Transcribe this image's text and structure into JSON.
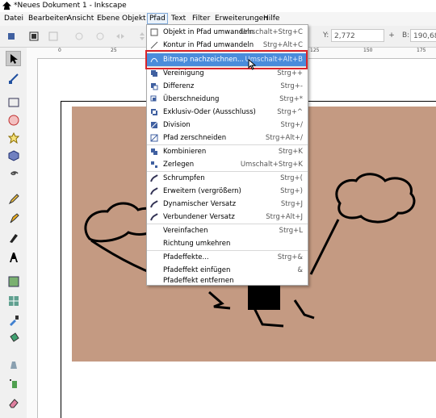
{
  "window": {
    "title": "*Neues Dokument 1 - Inkscape"
  },
  "menubar": {
    "items": [
      "Datei",
      "Bearbeiten",
      "Ansicht",
      "Ebene",
      "Objekt",
      "Pfad",
      "Text",
      "Filter",
      "Erweiterungen",
      "Hilfe"
    ],
    "active": "Pfad"
  },
  "toolbar": {
    "y_label": "Y:",
    "y_value": "2,772",
    "b_label": "B:",
    "b_value": "190,68",
    "minus": "–",
    "plus": "+"
  },
  "ruler": {
    "ticks": [
      "0",
      "25",
      "125",
      "150",
      "175"
    ]
  },
  "path_menu": {
    "items": [
      {
        "label": "Objekt in Pfad umwandeln",
        "shortcut": "Umschalt+Strg+C"
      },
      {
        "label": "Kontur in Pfad umwandeln",
        "shortcut": "Strg+Alt+C"
      },
      {
        "label": "Bitmap nachzeichnen...",
        "shortcut": "Umschalt+Alt+B"
      },
      {
        "label": "Vereinigung",
        "shortcut": "Strg++"
      },
      {
        "label": "Differenz",
        "shortcut": "Strg+-"
      },
      {
        "label": "Überschneidung",
        "shortcut": "Strg+*"
      },
      {
        "label": "Exklusiv-Oder (Ausschluss)",
        "shortcut": "Strg+^"
      },
      {
        "label": "Division",
        "shortcut": "Strg+/"
      },
      {
        "label": "Pfad zerschneiden",
        "shortcut": "Strg+Alt+/"
      },
      {
        "label": "Kombinieren",
        "shortcut": "Strg+K"
      },
      {
        "label": "Zerlegen",
        "shortcut": "Umschalt+Strg+K"
      },
      {
        "label": "Schrumpfen",
        "shortcut": "Strg+("
      },
      {
        "label": "Erweitern (vergrößern)",
        "shortcut": "Strg+)"
      },
      {
        "label": "Dynamischer Versatz",
        "shortcut": "Strg+J"
      },
      {
        "label": "Verbundener Versatz",
        "shortcut": "Strg+Alt+J"
      },
      {
        "label": "Vereinfachen",
        "shortcut": "Strg+L"
      },
      {
        "label": "Richtung umkehren",
        "shortcut": ""
      },
      {
        "label": "Pfadeffekte...",
        "shortcut": "Strg+&"
      },
      {
        "label": "Pfadeffekt einfügen",
        "shortcut": "&"
      },
      {
        "label": "Pfadeffekt entfernen",
        "shortcut": ""
      }
    ],
    "highlighted_index": 2
  },
  "colors": {
    "highlight": "#4a8cdb",
    "annotation": "#d9252b",
    "photo": "#c49a82"
  }
}
